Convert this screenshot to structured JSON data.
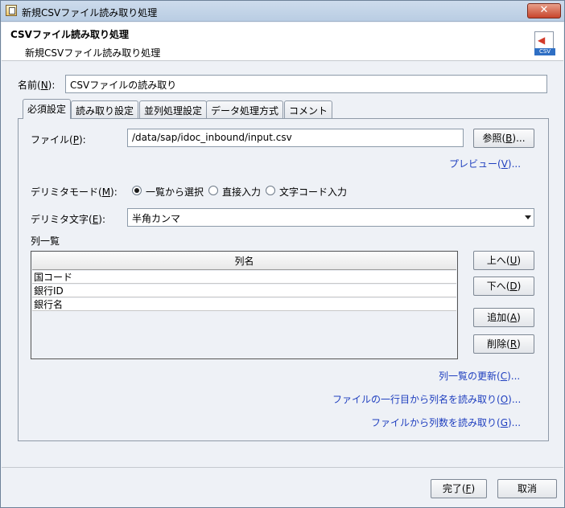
{
  "window": {
    "title": "新規CSVファイル読み取り処理",
    "close_label": "✕"
  },
  "banner": {
    "title": "CSVファイル読み取り処理",
    "subtitle": "新規CSVファイル読み取り処理",
    "icon_tag": "CSV"
  },
  "name_field": {
    "label": "名前(",
    "mnemonic": "N",
    "label_end": "):",
    "value": "CSVファイルの読み取り"
  },
  "tabs": [
    "必須設定",
    "読み取り設定",
    "並列処理設定",
    "データ処理方式",
    "コメント"
  ],
  "active_tab": "必須設定",
  "file_field": {
    "label": "ファイル(",
    "mnemonic": "P",
    "label_end": "):",
    "value": "/data/sap/idoc_inbound/input.csv"
  },
  "browse_button": {
    "label": "参照(",
    "mnemonic": "B",
    "label_end": ")..."
  },
  "preview_link": {
    "label": "プレビュー(",
    "mnemonic": "V",
    "label_end": ")..."
  },
  "delimiter_mode": {
    "label": "デリミタモード(",
    "mnemonic": "M",
    "label_end": "):",
    "options": [
      "一覧から選択",
      "直接入力",
      "文字コード入力"
    ],
    "selected_index": 0
  },
  "delimiter_char": {
    "label": "デリミタ文字(",
    "mnemonic": "E",
    "label_end": "):",
    "value": "半角カンマ"
  },
  "columns": {
    "label": "列一覧",
    "header": "列名",
    "rows": [
      "国コード",
      "銀行ID",
      "銀行名"
    ]
  },
  "column_buttons": {
    "up": {
      "label": "上へ(",
      "mnemonic": "U",
      "label_end": ")"
    },
    "down": {
      "label": "下へ(",
      "mnemonic": "D",
      "label_end": ")"
    },
    "add": {
      "label": "追加(",
      "mnemonic": "A",
      "label_end": ")"
    },
    "delete": {
      "label": "削除(",
      "mnemonic": "R",
      "label_end": ")"
    }
  },
  "links": {
    "refresh": {
      "label": "列一覧の更新(",
      "mnemonic": "C",
      "label_end": ")..."
    },
    "read_names": {
      "label": "ファイルの一行目から列名を読み取り(",
      "mnemonic": "O",
      "label_end": ")..."
    },
    "read_count": {
      "label": "ファイルから列数を読み取り(",
      "mnemonic": "G",
      "label_end": ")..."
    }
  },
  "footer": {
    "finish": {
      "label": "完了(",
      "mnemonic": "F",
      "label_end": ")"
    },
    "cancel": {
      "label": "取消"
    }
  }
}
